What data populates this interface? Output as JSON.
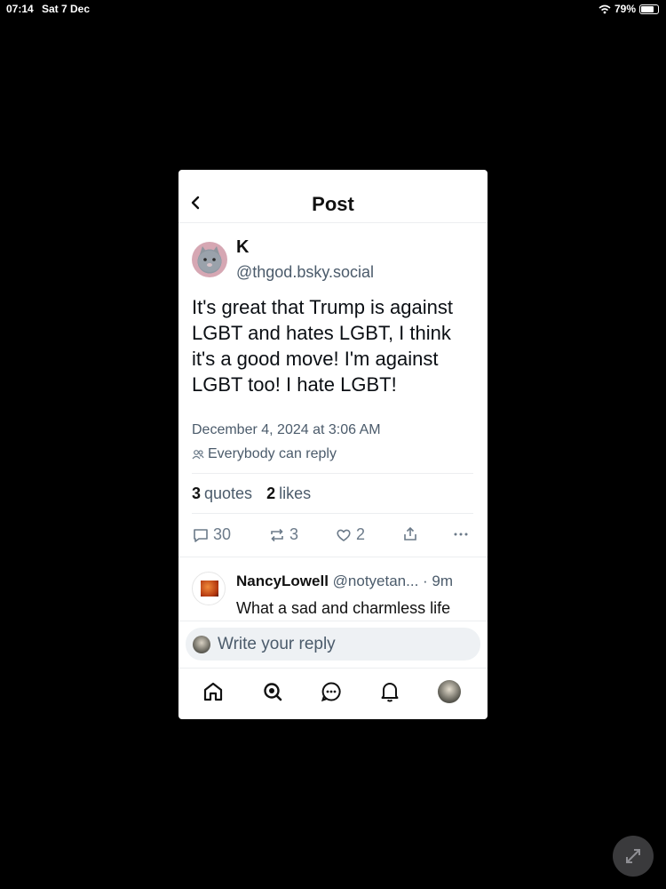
{
  "status_bar": {
    "time": "07:14",
    "date": "Sat 7 Dec",
    "battery": "79%",
    "battery_level": 0.79
  },
  "header": {
    "title": "Post",
    "back_icon": "chevron-left-icon"
  },
  "post": {
    "author_name": "K",
    "author_handle": "@thgod.bsky.social",
    "text": "It's great that Trump is against LGBT and hates LGBT, I think it's a good move! I'm against LGBT too! I hate LGBT!",
    "date": "December 4, 2024 at 3:06 AM",
    "reply_setting": "Everybody can reply",
    "quotes_count": "3",
    "quotes_label": "quotes",
    "likes_count": "2",
    "likes_label": "likes",
    "actions": {
      "replies": "30",
      "reposts": "3",
      "likes": "2"
    }
  },
  "reply": {
    "name": "NancyLowell",
    "handle": "@notyetan...",
    "time": "· 9m",
    "text": "What a sad and charmless life"
  },
  "composer": {
    "placeholder": "Write your reply"
  },
  "colors": {
    "accent": "#4b5b6b",
    "icon": "#6b7a89",
    "background": "#000000"
  }
}
